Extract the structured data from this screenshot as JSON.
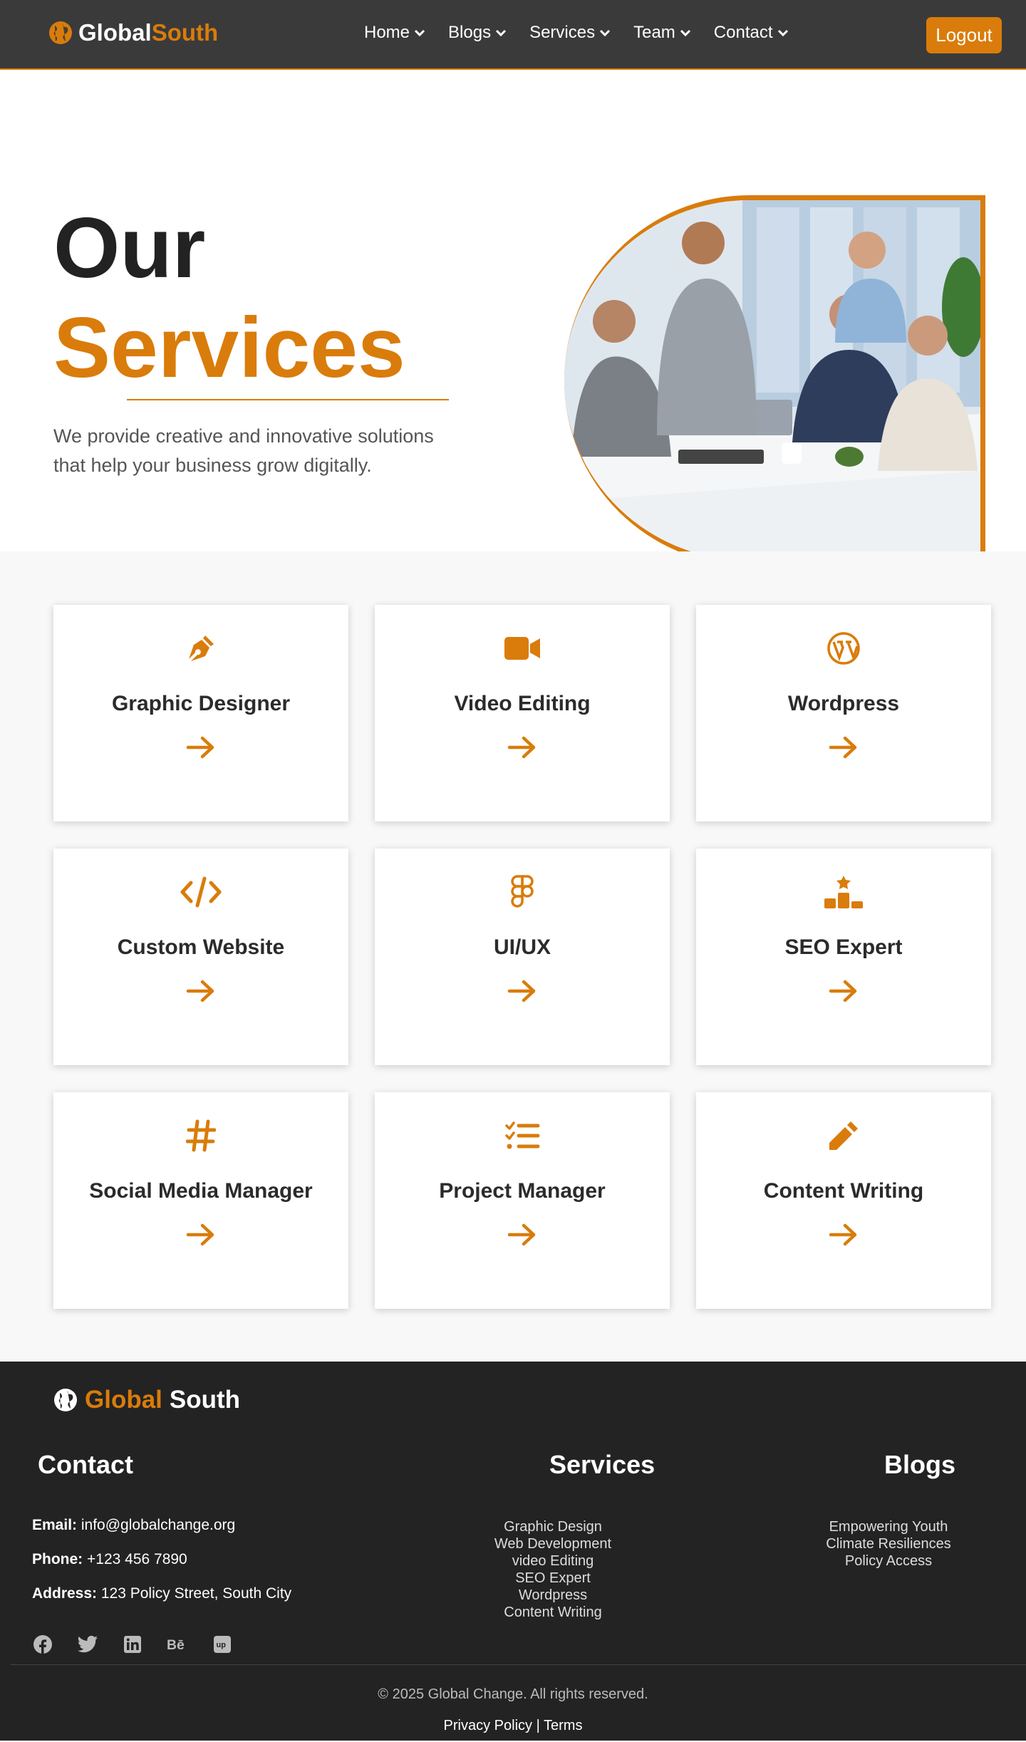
{
  "brand": {
    "word1": "Global",
    "word2": "South"
  },
  "nav": {
    "items": [
      "Home",
      "Blogs",
      "Services",
      "Team",
      "Contact"
    ],
    "logout": "Logout"
  },
  "hero": {
    "title1": "Our",
    "title2": "Services",
    "description": "We provide creative and innovative solutions that help your business grow digitally."
  },
  "services": [
    {
      "title": "Graphic Designer",
      "icon": "pen-nib-icon"
    },
    {
      "title": "Video Editing",
      "icon": "video-camera-icon"
    },
    {
      "title": "Wordpress",
      "icon": "wordpress-icon"
    },
    {
      "title": "Custom Website",
      "icon": "code-icon"
    },
    {
      "title": "UI/UX",
      "icon": "figma-icon"
    },
    {
      "title": "SEO Expert",
      "icon": "ranking-star-icon"
    },
    {
      "title": "Social Media Manager",
      "icon": "hashtag-icon"
    },
    {
      "title": "Project Manager",
      "icon": "list-check-icon"
    },
    {
      "title": "Content Writing",
      "icon": "pencil-icon"
    }
  ],
  "footer": {
    "brand1": "Global",
    "brand2": "South",
    "contact_heading": "Contact",
    "services_heading": "Services",
    "blogs_heading": "Blogs",
    "email_label": "Email:",
    "email": "info@globalchange.org",
    "phone_label": "Phone:",
    "phone": "+123 456 7890",
    "address_label": "Address:",
    "address": "123 Policy Street, South City",
    "service_links": [
      "Graphic Design",
      "Web Development",
      "video Editing",
      "SEO Expert",
      "Wordpress",
      "Content Writing"
    ],
    "blog_links": [
      "Empowering Youth",
      "Climate Resiliences",
      "Policy Access"
    ],
    "copyright": "© 2025 Global Change. All rights reserved.",
    "privacy": "Privacy Policy",
    "separator": "|",
    "terms": "Terms"
  },
  "colors": {
    "accent": "#d97c0b",
    "nav_bg": "#3a3a3a",
    "footer_bg": "#232323"
  }
}
